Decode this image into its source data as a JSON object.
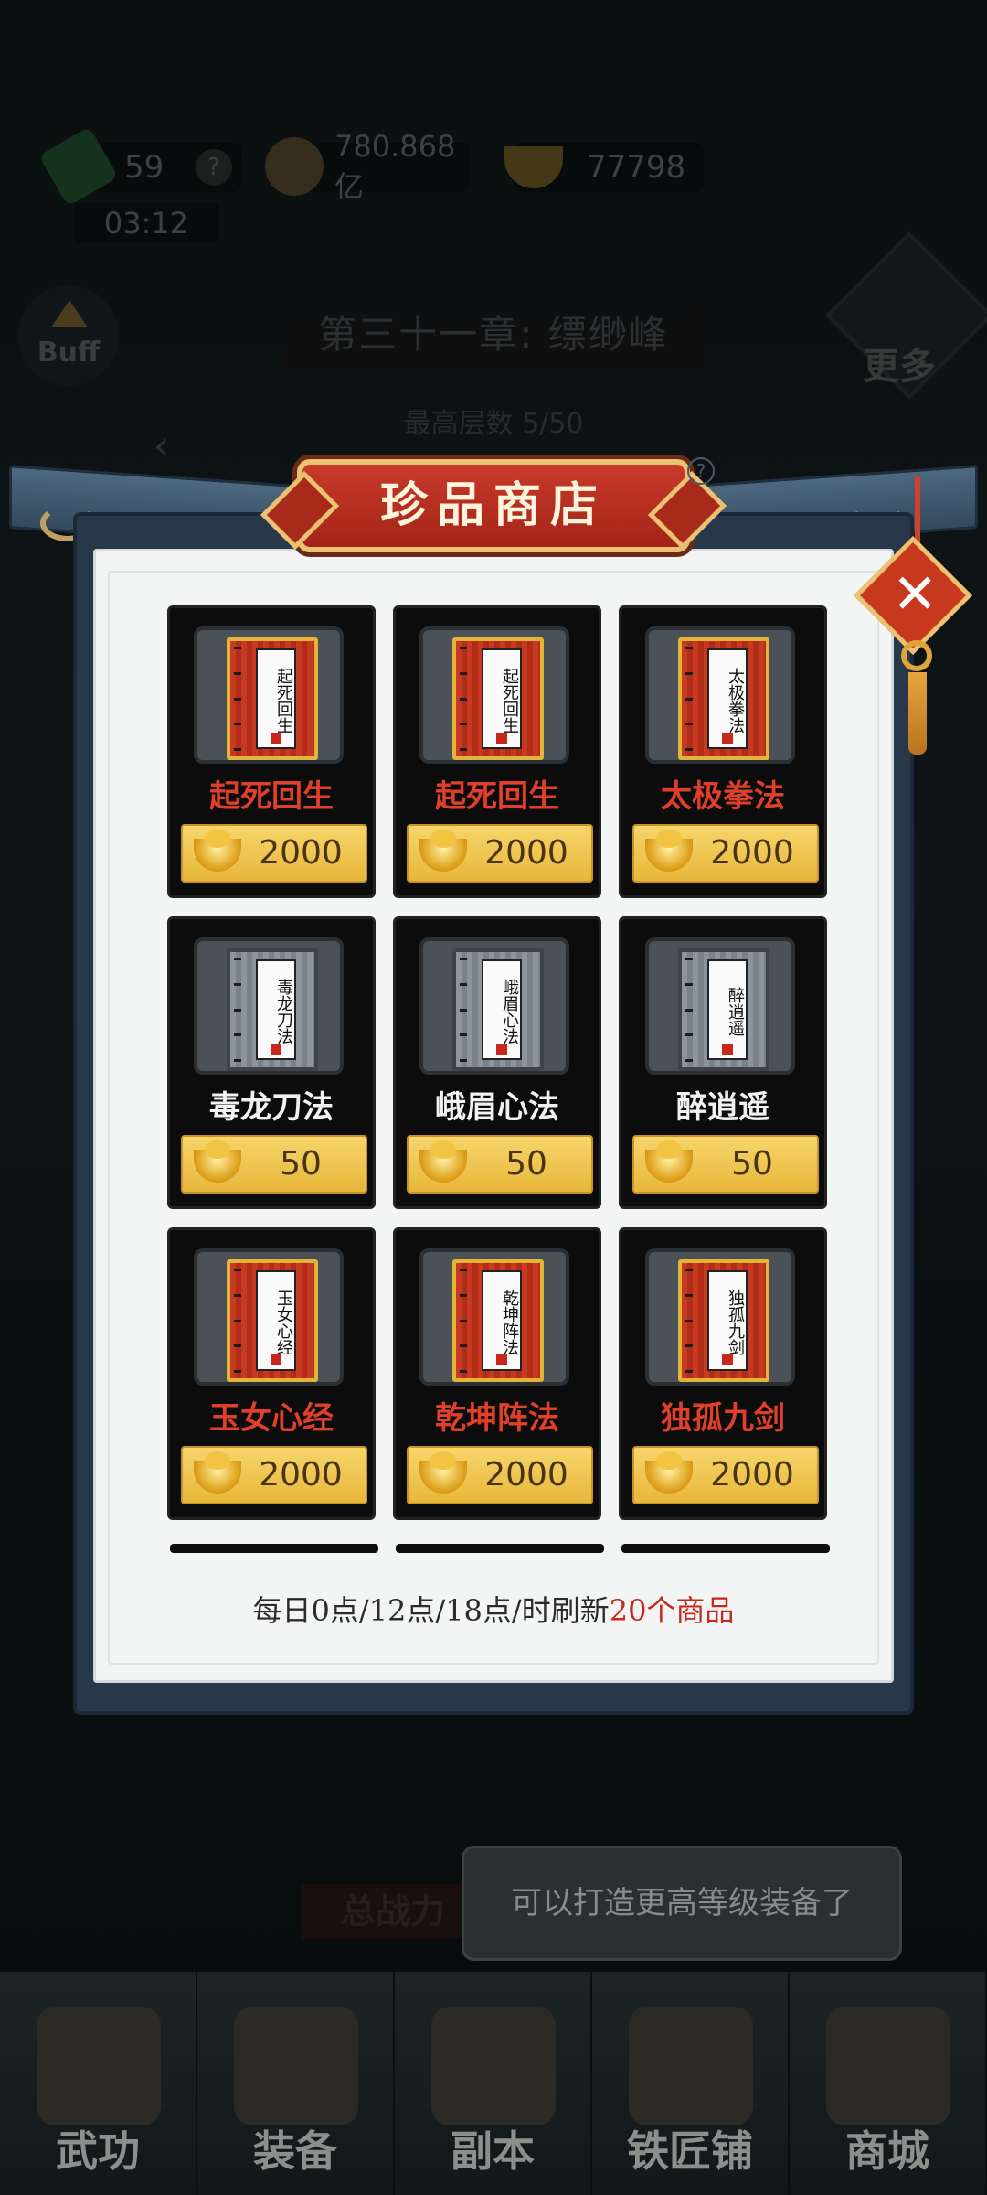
{
  "hud": {
    "stamina": "59",
    "stamina_help": "?",
    "timer": "03:12",
    "coins": "780.868亿",
    "ingots": "77798",
    "buff_label": "Buff",
    "chapter": "第三十一章: 缥缈峰",
    "max_floor": "最高层数 5/50",
    "more_label": "更多"
  },
  "shop": {
    "title": "珍品商店",
    "items": [
      {
        "name": "起死回生",
        "cover": "起死回生",
        "price": "2000",
        "rarity": "red"
      },
      {
        "name": "起死回生",
        "cover": "起死回生",
        "price": "2000",
        "rarity": "red"
      },
      {
        "name": "太极拳法",
        "cover": "太极拳法",
        "price": "2000",
        "rarity": "red"
      },
      {
        "name": "毒龙刀法",
        "cover": "毒龙刀法",
        "price": "50",
        "rarity": "white"
      },
      {
        "name": "峨眉心法",
        "cover": "峨眉心法",
        "price": "50",
        "rarity": "white"
      },
      {
        "name": "醉逍遥",
        "cover": "醉逍遥",
        "price": "50",
        "rarity": "white"
      },
      {
        "name": "玉女心经",
        "cover": "玉女心经",
        "price": "2000",
        "rarity": "red"
      },
      {
        "name": "乾坤阵法",
        "cover": "乾坤阵法",
        "price": "2000",
        "rarity": "red"
      },
      {
        "name": "独孤九剑",
        "cover": "独孤九剑",
        "price": "2000",
        "rarity": "red"
      }
    ],
    "refresh_prefix": "每日0点/12点/18点/时刷新",
    "refresh_highlight": "20个商品"
  },
  "toast": "可以打造更高等级装备了",
  "power_label": "总战力",
  "nav": [
    "武功",
    "装备",
    "副本",
    "铁匠铺",
    "商城"
  ],
  "colors": {
    "accent_red": "#c8281b",
    "gold": "#e8b73a",
    "panel_blue": "#27384a"
  }
}
